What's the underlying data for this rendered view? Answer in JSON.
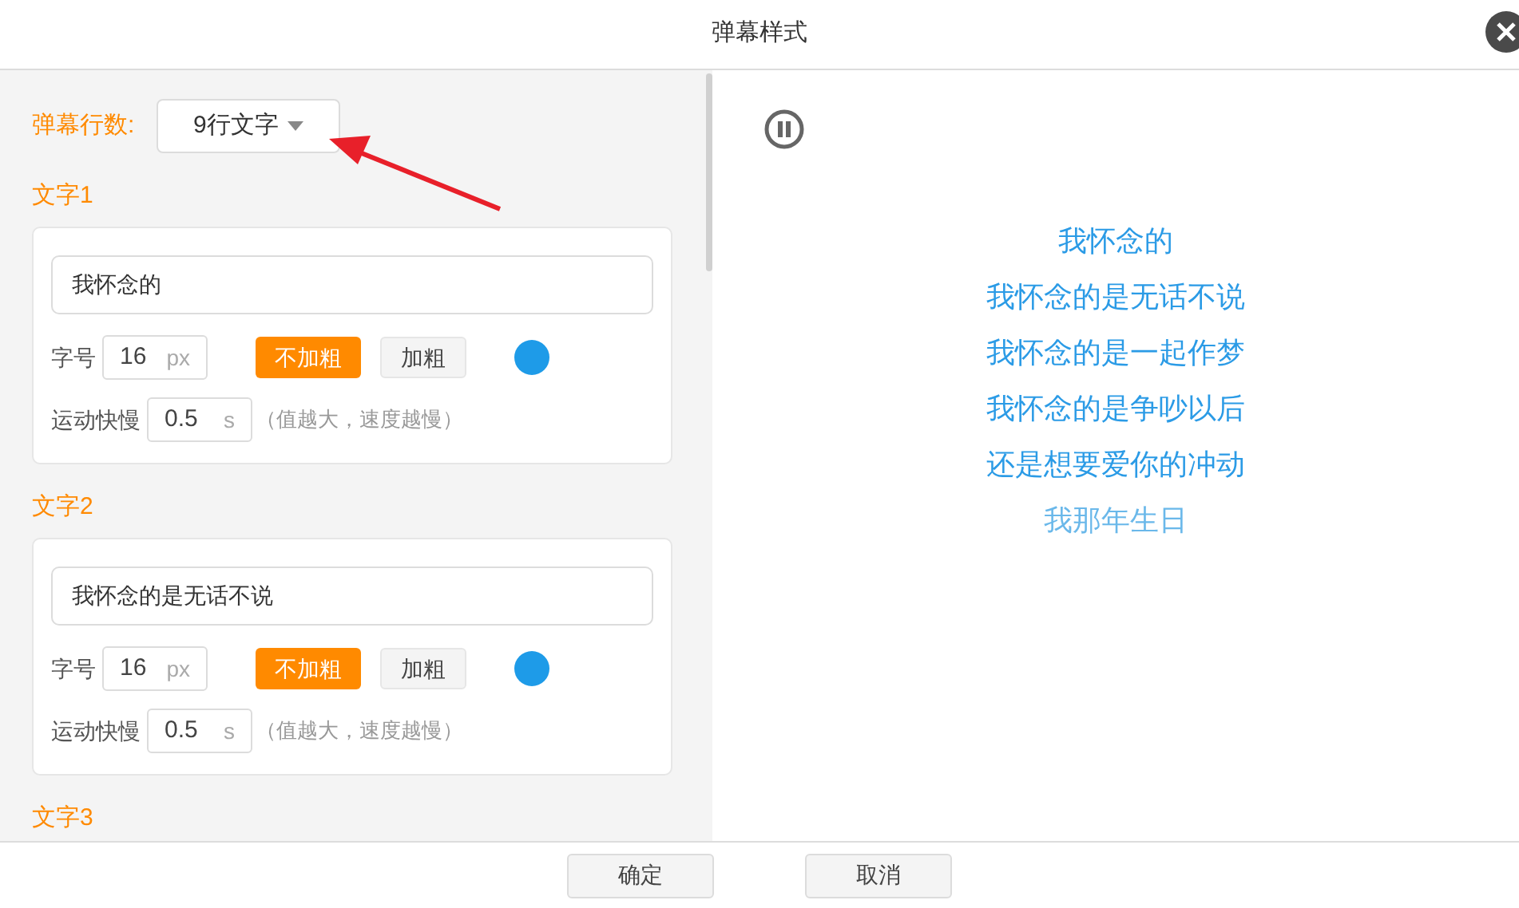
{
  "window": {
    "title": "弹幕样式"
  },
  "rows_setting": {
    "label": "弹幕行数:",
    "value": "9行文字"
  },
  "texts": [
    {
      "heading": "文字1",
      "value": "我怀念的",
      "size_label": "字号",
      "size": "16",
      "size_unit": "px",
      "weight_options": [
        {
          "label": "不加粗",
          "selected": true
        },
        {
          "label": "加粗",
          "selected": false
        }
      ],
      "color": "#1e9be8",
      "speed_label": "运动快慢",
      "speed": "0.5",
      "speed_unit": "s",
      "speed_hint": "（值越大，速度越慢）"
    },
    {
      "heading": "文字2",
      "value": "我怀念的是无话不说",
      "size_label": "字号",
      "size": "16",
      "size_unit": "px",
      "weight_options": [
        {
          "label": "不加粗",
          "selected": true
        },
        {
          "label": "加粗",
          "selected": false
        }
      ],
      "color": "#1e9be8",
      "speed_label": "运动快慢",
      "speed": "0.5",
      "speed_unit": "s",
      "speed_hint": "（值越大，速度越慢）"
    },
    {
      "heading": "文字3"
    }
  ],
  "preview": {
    "lines": [
      {
        "text": "我怀念的",
        "fading": false
      },
      {
        "text": "我怀念的是无话不说",
        "fading": false
      },
      {
        "text": "我怀念的是一起作梦",
        "fading": false
      },
      {
        "text": "我怀念的是争吵以后",
        "fading": false
      },
      {
        "text": "还是想要爱你的冲动",
        "fading": false
      },
      {
        "text": "我那年生日",
        "fading": true
      }
    ]
  },
  "buttons": [
    "确定",
    "取消"
  ]
}
